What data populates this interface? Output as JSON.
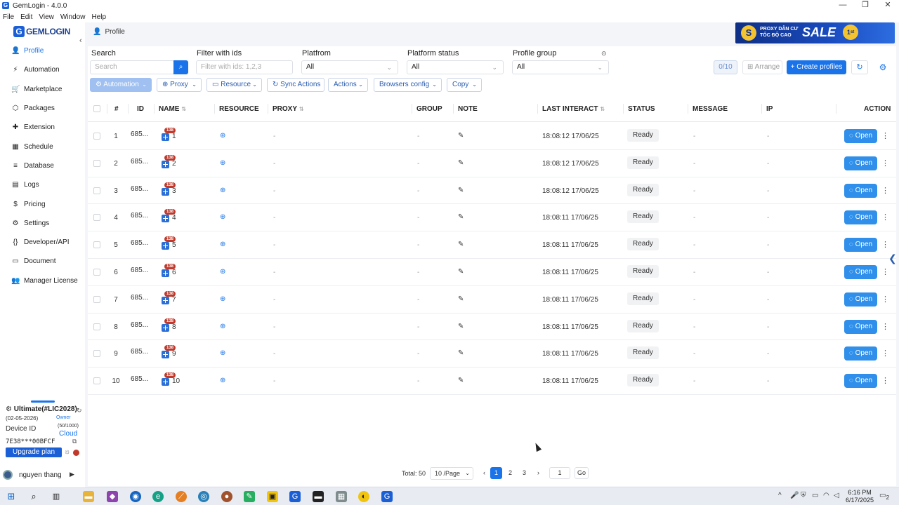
{
  "window": {
    "title": "GemLogin - 4.0.0",
    "controls": [
      "—",
      "❐",
      "✕"
    ]
  },
  "menu": [
    "File",
    "Edit",
    "View",
    "Window",
    "Help"
  ],
  "logo": {
    "mark": "G",
    "text": "GEMLOGIN"
  },
  "sidebar": {
    "items": [
      {
        "label": "Profile",
        "icon": "user-icon",
        "glyph": "👤"
      },
      {
        "label": "Automation",
        "icon": "bolt-icon",
        "glyph": "⚡"
      },
      {
        "label": "Marketplace",
        "icon": "cart-icon",
        "glyph": "🛒"
      },
      {
        "label": "Packages",
        "icon": "package-icon",
        "glyph": "⬡"
      },
      {
        "label": "Extension",
        "icon": "puzzle-icon",
        "glyph": "✚"
      },
      {
        "label": "Schedule",
        "icon": "calendar-icon",
        "glyph": "▦"
      },
      {
        "label": "Database",
        "icon": "database-icon",
        "glyph": "≡"
      },
      {
        "label": "Logs",
        "icon": "file-icon",
        "glyph": "▤"
      },
      {
        "label": "Pricing",
        "icon": "dollar-icon",
        "glyph": "$"
      },
      {
        "label": "Settings",
        "icon": "gear-icon",
        "glyph": "⚙"
      },
      {
        "label": "Developer/API",
        "icon": "code-icon",
        "glyph": "{}"
      },
      {
        "label": "Document",
        "icon": "document-icon",
        "glyph": "▭"
      },
      {
        "label": "Manager License",
        "icon": "users-icon",
        "glyph": "👥"
      }
    ]
  },
  "plan": {
    "name": "Ultimate(#LIC2028)",
    "date": "(02-05-2026)",
    "owner": "Owner",
    "device_label": "Device ID",
    "count": "(50/1000)",
    "cloud": "Cloud",
    "device_id": "7E38***00BFCF",
    "upgrade": "Upgrade plan"
  },
  "user": {
    "name": "nguyen thang"
  },
  "breadcrumb": "Profile",
  "banner": {
    "line1": "PROXY DÂN CƯ",
    "line2": "TỐC ĐỘ CAO",
    "sale": "SALE",
    "badge": "1ˢᵗ"
  },
  "filters": {
    "search": {
      "label": "Search",
      "placeholder": "Search"
    },
    "ids": {
      "label": "Filter with ids",
      "placeholder": "Filter with ids: 1,2,3"
    },
    "platform": {
      "label": "Platfrom",
      "value": "All"
    },
    "platform_status": {
      "label": "Platform status",
      "value": "All"
    },
    "profile_group": {
      "label": "Profile group",
      "value": "All"
    }
  },
  "toolbar": {
    "counter": "0/10",
    "arrange": "Arrange",
    "create": "+ Create profiles",
    "automation": "Automation",
    "proxy": "Proxy",
    "resource": "Resource",
    "sync": "Sync Actions",
    "actions": "Actions",
    "browsers": "Browsers config",
    "copy": "Copy"
  },
  "columns": [
    "#",
    "ID",
    "NAME",
    "RESOURCE",
    "PROXY",
    "GROUP",
    "NOTE",
    "LAST INTERACT",
    "STATUS",
    "MESSAGE",
    "IP",
    "ACTION"
  ],
  "rows": [
    {
      "num": "1",
      "id": "685...",
      "badge": "138",
      "name": "1",
      "proxy": "-",
      "group": "-",
      "last": "18:08:12 17/06/25",
      "status": "Ready",
      "message": "-",
      "ip": "-",
      "action": "Open"
    },
    {
      "num": "2",
      "id": "685...",
      "badge": "138",
      "name": "2",
      "proxy": "-",
      "group": "-",
      "last": "18:08:12 17/06/25",
      "status": "Ready",
      "message": "-",
      "ip": "-",
      "action": "Open"
    },
    {
      "num": "3",
      "id": "685...",
      "badge": "138",
      "name": "3",
      "proxy": "-",
      "group": "-",
      "last": "18:08:12 17/06/25",
      "status": "Ready",
      "message": "-",
      "ip": "-",
      "action": "Open"
    },
    {
      "num": "4",
      "id": "685...",
      "badge": "138",
      "name": "4",
      "proxy": "-",
      "group": "-",
      "last": "18:08:11 17/06/25",
      "status": "Ready",
      "message": "-",
      "ip": "-",
      "action": "Open"
    },
    {
      "num": "5",
      "id": "685...",
      "badge": "138",
      "name": "5",
      "proxy": "-",
      "group": "-",
      "last": "18:08:11 17/06/25",
      "status": "Ready",
      "message": "-",
      "ip": "-",
      "action": "Open"
    },
    {
      "num": "6",
      "id": "685...",
      "badge": "138",
      "name": "6",
      "proxy": "-",
      "group": "-",
      "last": "18:08:11 17/06/25",
      "status": "Ready",
      "message": "-",
      "ip": "-",
      "action": "Open"
    },
    {
      "num": "7",
      "id": "685...",
      "badge": "138",
      "name": "7",
      "proxy": "-",
      "group": "-",
      "last": "18:08:11 17/06/25",
      "status": "Ready",
      "message": "-",
      "ip": "-",
      "action": "Open"
    },
    {
      "num": "8",
      "id": "685...",
      "badge": "138",
      "name": "8",
      "proxy": "-",
      "group": "-",
      "last": "18:08:11 17/06/25",
      "status": "Ready",
      "message": "-",
      "ip": "-",
      "action": "Open"
    },
    {
      "num": "9",
      "id": "685...",
      "badge": "138",
      "name": "9",
      "proxy": "-",
      "group": "-",
      "last": "18:08:11 17/06/25",
      "status": "Ready",
      "message": "-",
      "ip": "-",
      "action": "Open"
    },
    {
      "num": "10",
      "id": "685...",
      "badge": "138",
      "name": "10",
      "proxy": "-",
      "group": "-",
      "last": "18:08:11 17/06/25",
      "status": "Ready",
      "message": "-",
      "ip": "-",
      "action": "Open"
    }
  ],
  "pagination": {
    "total": "Total: 50",
    "page_size": "10 /Page",
    "pages": [
      "1",
      "2",
      "3"
    ],
    "current": "1",
    "jump": "1",
    "go": "Go"
  },
  "taskbar": {
    "time": "6:16 PM",
    "date": "6/17/2025",
    "notifications": "2"
  },
  "colors": {
    "accent": "#1a73e8",
    "badge": "#c0392b",
    "open": "#2f8fea"
  }
}
